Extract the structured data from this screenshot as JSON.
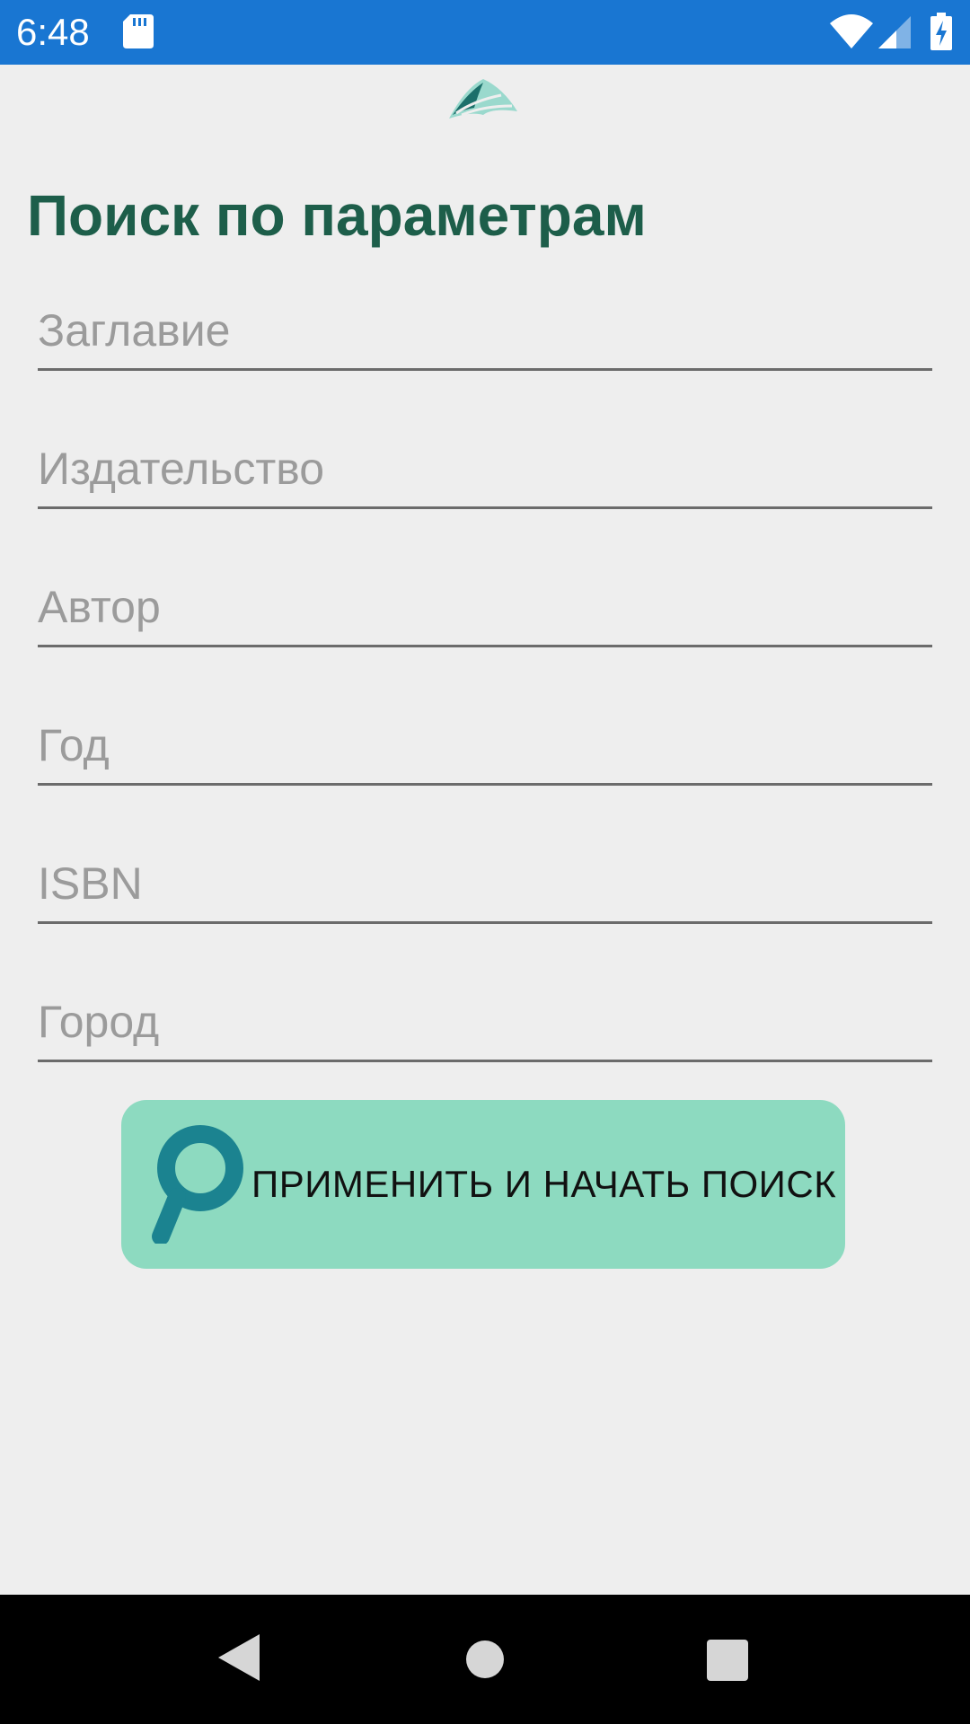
{
  "status_bar": {
    "time": "6:48",
    "icons": [
      "sd-card-icon",
      "wifi-icon",
      "cell-signal-icon",
      "battery-charging-icon"
    ]
  },
  "header": {
    "logo": "book-logo-icon",
    "title": "Поиск по параметрам"
  },
  "form": {
    "fields": [
      {
        "placeholder": "Заглавие",
        "value": ""
      },
      {
        "placeholder": "Издательство",
        "value": ""
      },
      {
        "placeholder": "Автор",
        "value": ""
      },
      {
        "placeholder": "Год",
        "value": ""
      },
      {
        "placeholder": "ISBN",
        "value": ""
      },
      {
        "placeholder": "Город",
        "value": ""
      }
    ],
    "submit": {
      "label": "ПРИМЕНИТЬ И НАЧАТЬ ПОИСК",
      "icon": "magnifier-icon"
    }
  },
  "nav_bar": {
    "buttons": [
      "back-icon",
      "home-icon",
      "recents-icon"
    ]
  },
  "colors": {
    "status_bar": "#1976d2",
    "title": "#1d5e4a",
    "button_bg": "#8ddac0",
    "magnifier": "#1b8390",
    "background": "#eeeeee"
  }
}
